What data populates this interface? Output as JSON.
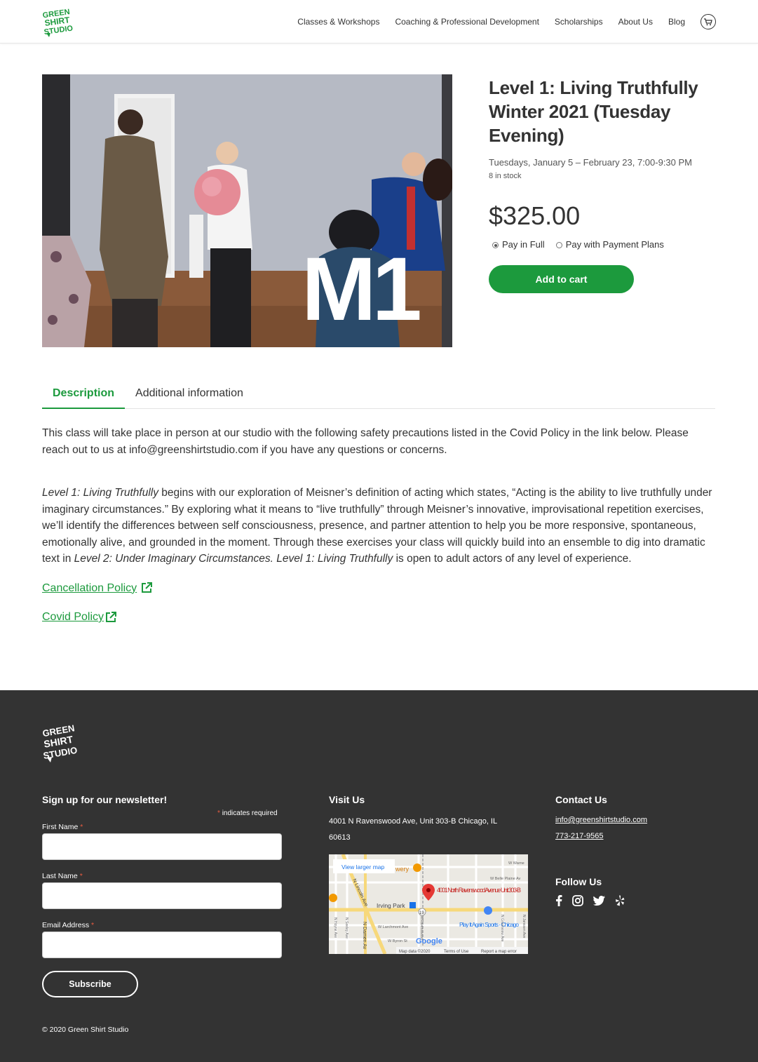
{
  "header": {
    "logo_text": "GREEN SHIRT STUDIO",
    "nav": [
      "Classes & Workshops",
      "Coaching & Professional Development",
      "Scholarships",
      "About Us",
      "Blog"
    ]
  },
  "product": {
    "image_overlay": "M1",
    "title": "Level 1: Living Truthfully Winter 2021 (Tuesday Evening)",
    "dates": "Tuesdays, January 5 – February 23, 7:00-9:30 PM",
    "stock": "8 in stock",
    "price": "$325.00",
    "pay_full": "Pay in Full",
    "pay_plans": "Pay with Payment Plans",
    "add_to_cart": "Add to cart"
  },
  "tabs": [
    "Description",
    "Additional information"
  ],
  "description": {
    "para1": "This class will take place in person at our studio with the following safety precautions listed in the Covid Policy in the link below. Please reach out to us at info@greenshirtstudio.com if you have any questions or concerns.",
    "para2_italic1": "Level 1: Living Truthfully",
    "para2_text1": " begins with our exploration of Meisner’s definition of acting which states, “Acting is the ability to live truthfully under imaginary circumstances.” By exploring what it means to “live truthfully” through Meisner’s innovative, improvisational repetition exercises, we’ll identify the differences between self consciousness, presence, and partner attention to help you be more responsive, spontaneous, emotionally alive, and grounded in the moment. Through these exercises your class will quickly build into an ensemble to dig into dramatic text in ",
    "para2_italic2": "Level 2: Under Imaginary Circumstances. Level 1: Living Truthfully",
    "para2_text2": " is open to adult actors of any level of experience.",
    "cancellation_link": "Cancellation Policy",
    "covid_link": "Covid Policy"
  },
  "footer": {
    "newsletter_heading": "Sign up for our newsletter!",
    "required_note": "indicates required",
    "first_name_label": "First Name",
    "last_name_label": "Last Name",
    "email_label": "Email Address",
    "subscribe": "Subscribe",
    "copyright": "© 2020 Green Shirt Studio",
    "visit_heading": "Visit Us",
    "address": "4001 N Ravenswood Ave, Unit 303-B Chicago, IL 60613",
    "map": {
      "larger_map": "View larger map",
      "pin_label": "4001 North Ravenswood Avenue Unit 303-B",
      "irving_park": "Irving Park",
      "play_it_again": "Play It Again Sports - Chicago",
      "brewery": "wery",
      "google": "Google",
      "map_data": "Map data ©2020",
      "terms": "Terms of Use",
      "report": "Report a map error",
      "street_lincoln": "N Lincoln Ave",
      "street_damen": "N Damen Av",
      "street_larchmont": "W Larchmont Ave",
      "street_byron": "W Byron St",
      "street_belle": "W Belle Plaine Av",
      "street_warner": "W Warne",
      "street_hoyne": "N Hoyne Ave",
      "street_seeley": "N Seeley Ave",
      "street_ravenswood": "N Ravenswood",
      "street_greenview": "N Greenview Ave",
      "street_janssen": "N Janssen Ave",
      "route_badge": "19"
    },
    "contact_heading": "Contact Us",
    "email": "info@greenshirtstudio.com",
    "phone": "773-217-9565",
    "follow_heading": "Follow Us",
    "social_icons": [
      "facebook-icon",
      "instagram-icon",
      "twitter-icon",
      "yelp-icon"
    ]
  },
  "colors": {
    "brand_green": "#1c9a3d",
    "footer_bg": "#333333",
    "required": "#e85c41"
  }
}
